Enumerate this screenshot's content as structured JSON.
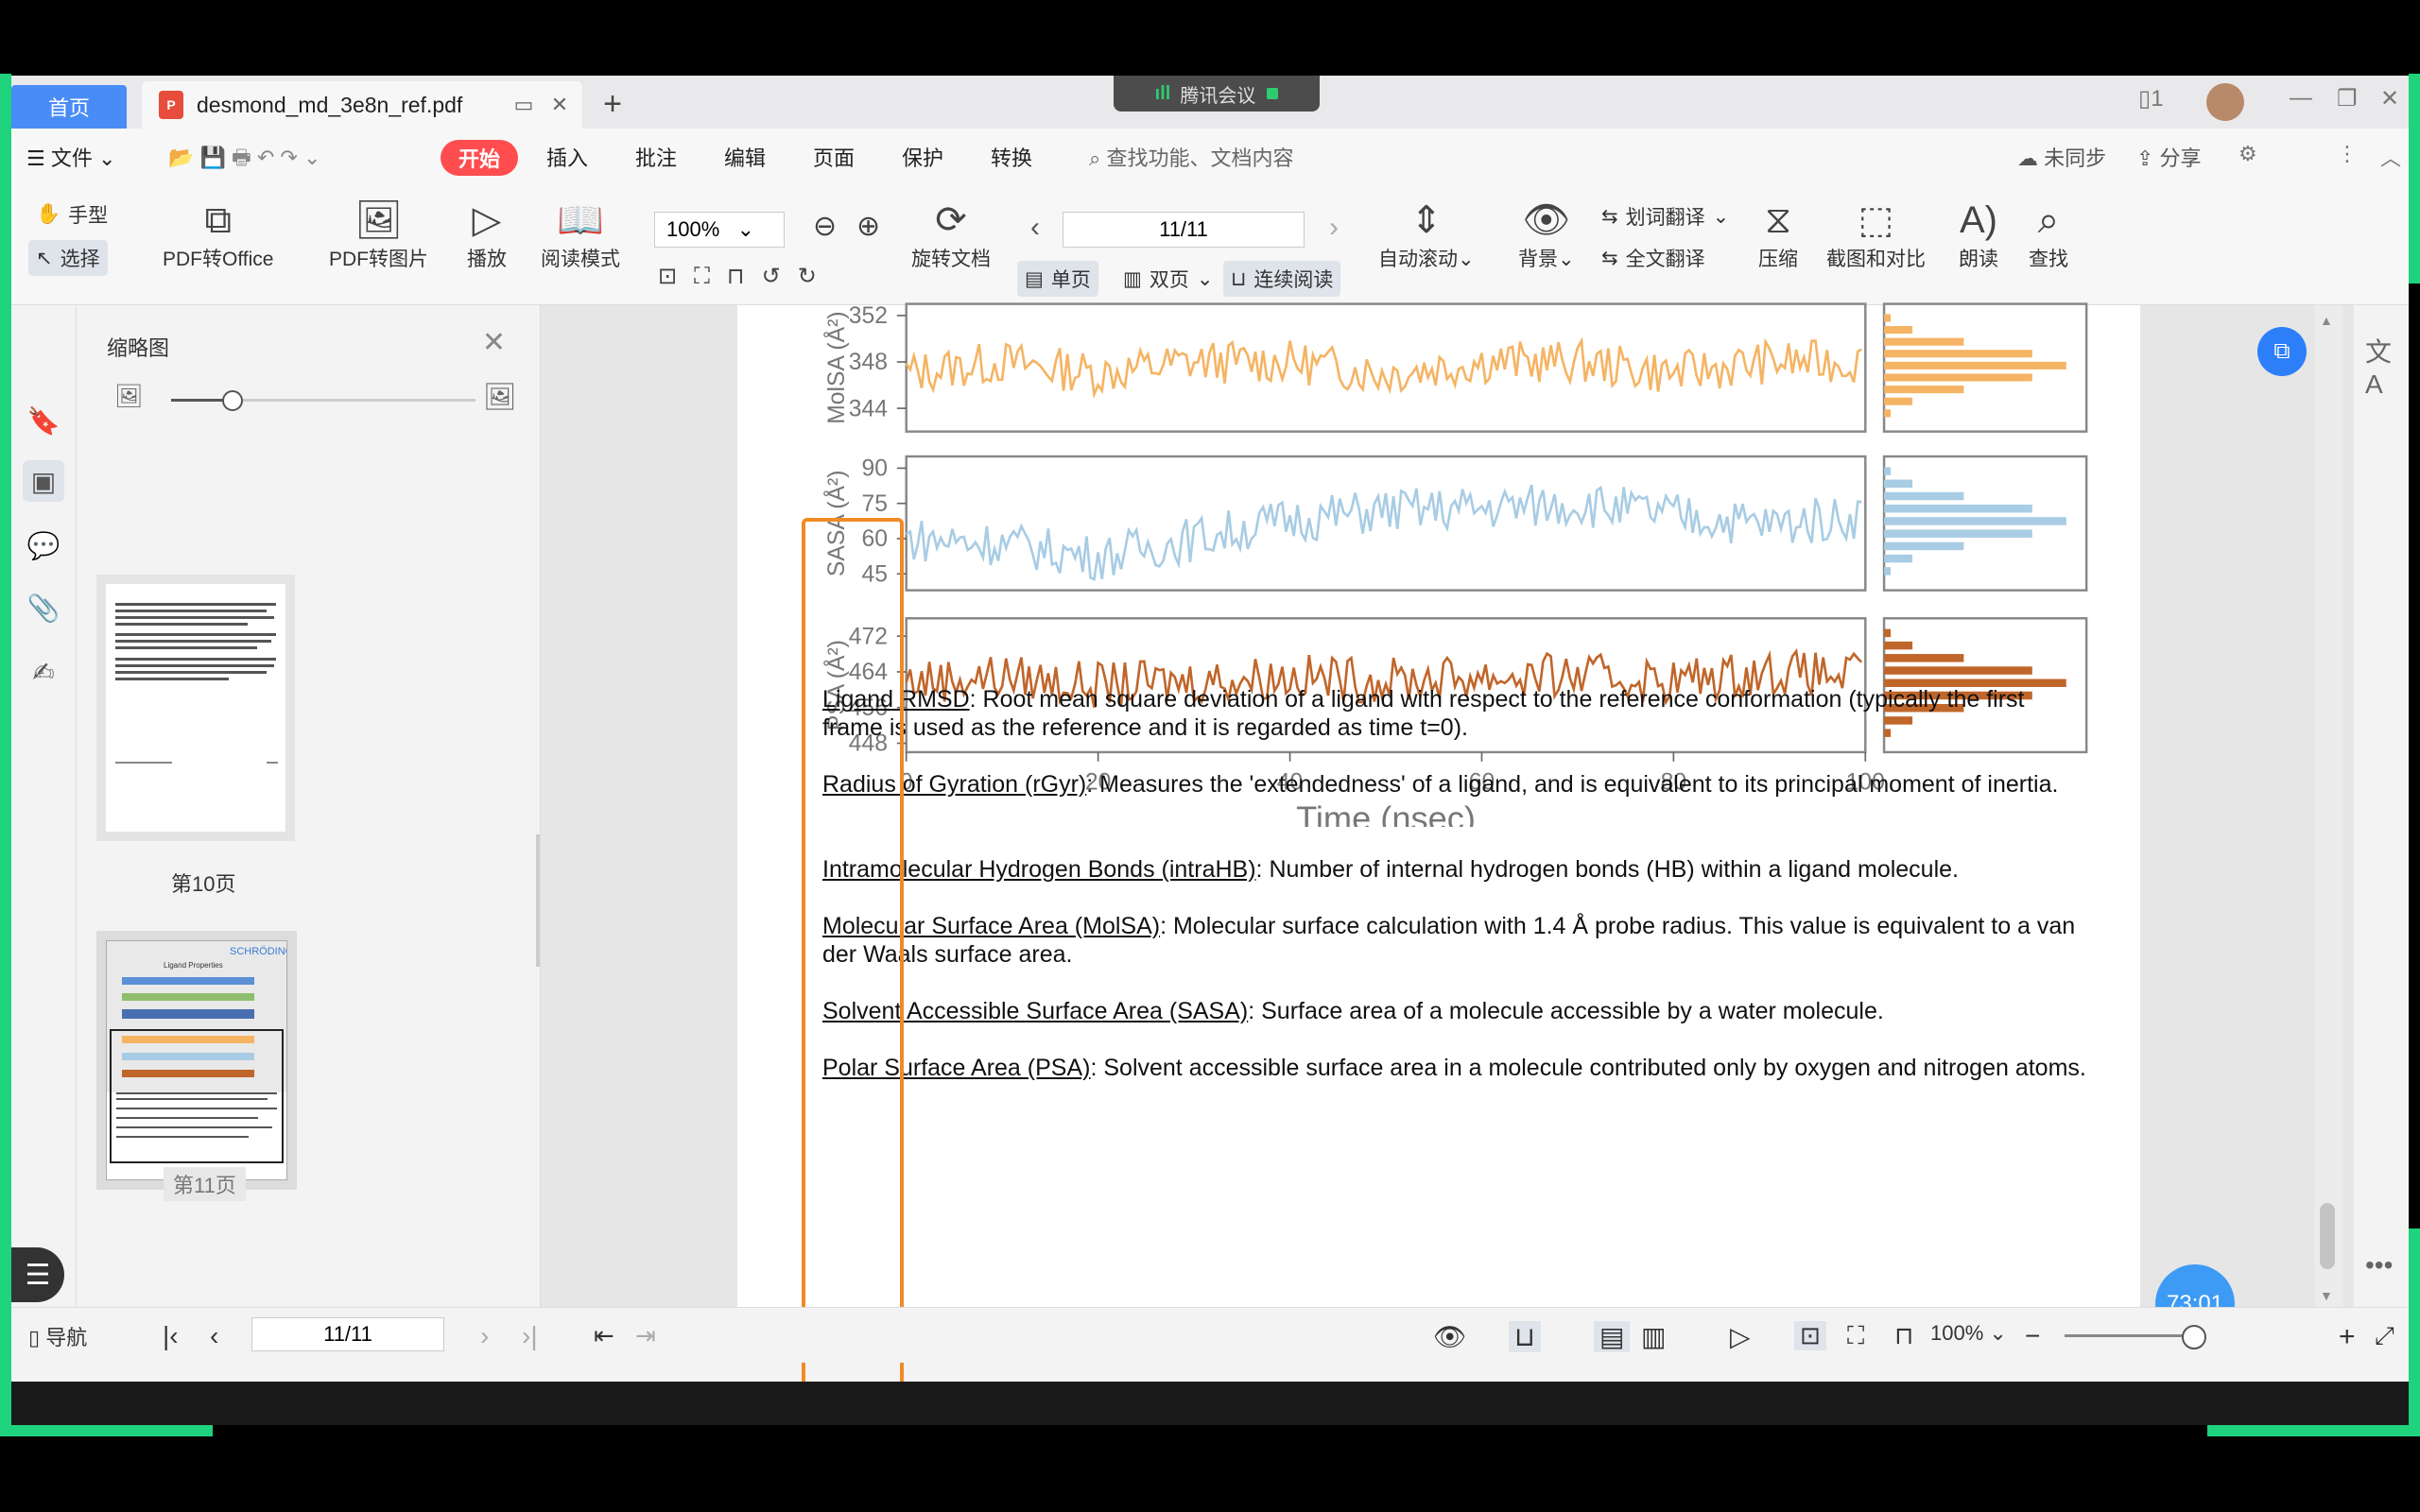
{
  "tabs": {
    "home": "首页",
    "document": "desmond_md_3e8n_ref.pdf"
  },
  "meeting": {
    "label": "腾讯会议"
  },
  "menu": {
    "file": "文件",
    "start": "开始",
    "insert": "插入",
    "annotate": "批注",
    "edit": "编辑",
    "page": "页面",
    "protect": "保护",
    "convert": "转换",
    "search_placeholder": "查找功能、文档内容",
    "right1": "未同步",
    "right2": "分享"
  },
  "toolbar": {
    "hand": "手型",
    "select": "选择",
    "pdf_office": "PDF转Office",
    "pdf_image": "PDF转图片",
    "play": "播放",
    "read_mode": "阅读模式",
    "zoom": "100%",
    "rotate": "旋转文档",
    "page_indicator": "11/11",
    "single": "单页",
    "double": "双页",
    "continuous": "连续阅读",
    "auto_scroll": "自动滚动",
    "background": "背景",
    "word_translate": "划词翻译",
    "full_translate": "全文翻译",
    "compress": "压缩",
    "screenshot_compare": "截图和对比",
    "read_aloud": "朗读",
    "find": "查找"
  },
  "thumbnails": {
    "title": "缩略图",
    "page10_label": "第10页",
    "page11_label": "第11页",
    "page11_brand": "SCHRÖDINGER",
    "page11_heading": "Ligand Properties"
  },
  "chart_data": [
    {
      "type": "line",
      "ylabel": "MolSA (Å²)",
      "yticks": [
        344,
        348,
        352
      ],
      "ylim": [
        342,
        353
      ],
      "xlim": [
        0,
        100
      ],
      "color": "#f5b464",
      "series": [
        {
          "x": [
            0,
            10,
            20,
            30,
            40,
            50,
            60,
            70,
            80,
            90,
            100
          ],
          "values": [
            347,
            348,
            347,
            348,
            348,
            347,
            348,
            348,
            347,
            348,
            348
          ]
        }
      ]
    },
    {
      "type": "line",
      "ylabel": "SASA (Å²)",
      "yticks": [
        45,
        60,
        75,
        90
      ],
      "ylim": [
        38,
        95
      ],
      "xlim": [
        0,
        100
      ],
      "color": "#a8cce4",
      "series": [
        {
          "x": [
            0,
            10,
            20,
            30,
            40,
            50,
            60,
            70,
            80,
            90,
            100
          ],
          "values": [
            60,
            58,
            52,
            60,
            68,
            72,
            73,
            75,
            70,
            66,
            70
          ]
        }
      ]
    },
    {
      "type": "line",
      "ylabel": "PSA (Å²)",
      "yticks": [
        448,
        456,
        464,
        472
      ],
      "ylim": [
        446,
        476
      ],
      "xlim": [
        0,
        100
      ],
      "xticks": [
        0,
        20,
        40,
        60,
        80,
        100
      ],
      "xlabel": "Time (nsec)",
      "color": "#c0662a",
      "series": [
        {
          "x": [
            0,
            10,
            20,
            30,
            40,
            50,
            60,
            70,
            80,
            90,
            100
          ],
          "values": [
            462,
            463,
            461,
            462,
            463,
            462,
            463,
            463,
            462,
            464,
            463
          ]
        }
      ]
    }
  ],
  "definitions": [
    {
      "term": "Ligand RMSD",
      "text": ": Root mean square deviation of a ligand with respect to the reference conformation (typically the first frame is used as the reference and it is regarded as time t=0)."
    },
    {
      "term": "Radius of Gyration (rGyr)",
      "text": ": Measures the 'extendedness' of a ligand, and is equivalent to its principal moment of inertia."
    },
    {
      "term": "Intramolecular Hydrogen Bonds (intraHB)",
      "text": ": Number of internal hydrogen bonds (HB) within a ligand molecule."
    },
    {
      "term": "Molecular Surface Area (MolSA)",
      "text": ": Molecular surface calculation with 1.4 Å probe radius. This value is equivalent to a van der Waals surface area."
    },
    {
      "term": "Solvent Accessible Surface Area (SASA)",
      "text": ": Surface area of a molecule accessible by a water molecule."
    },
    {
      "term": "Polar Surface Area (PSA)",
      "text": ": Solvent accessible surface area in a molecule contributed only by oxygen and nitrogen atoms."
    }
  ],
  "statusbar": {
    "nav": "导航",
    "page": "11/11",
    "zoom": "100%"
  },
  "timer": "73:01",
  "icons": {
    "pdf": "pdf-icon",
    "search": "search-icon",
    "hand": "hand-icon",
    "cursor": "cursor-icon",
    "bookmark": "bookmark-icon",
    "thumbnail": "thumbnail-icon",
    "comment": "comment-icon",
    "attachment": "paperclip-icon",
    "sign": "pen-icon",
    "translate": "translate-icon"
  }
}
